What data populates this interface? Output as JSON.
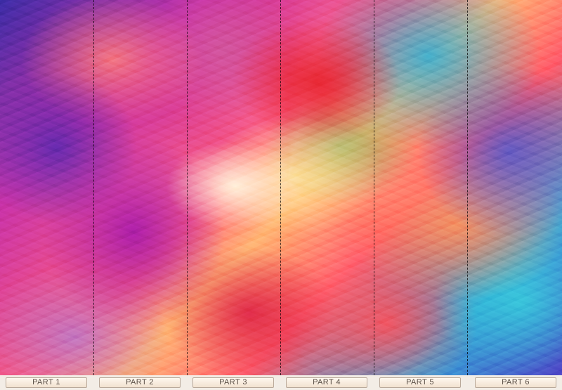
{
  "parts": [
    {
      "label": "PART 1"
    },
    {
      "label": "PART 2"
    },
    {
      "label": "PART 3"
    },
    {
      "label": "PART 4"
    },
    {
      "label": "PART 5"
    },
    {
      "label": "PART 6"
    }
  ]
}
